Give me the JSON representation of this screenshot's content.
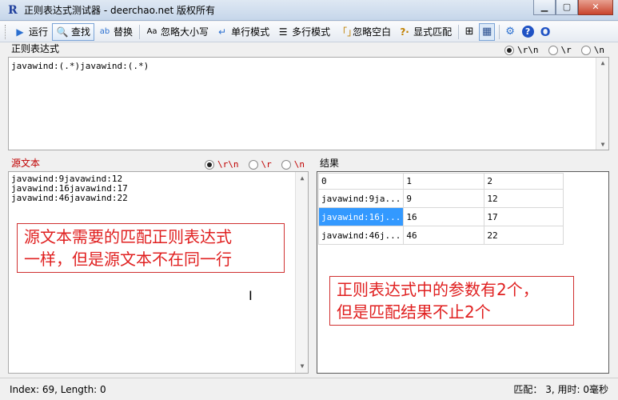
{
  "window": {
    "title": "正则表达式测试器 - deerchao.net 版权所有",
    "app_icon": "R",
    "min_label": "▁",
    "max_label": "▢",
    "close_label": "✕"
  },
  "toolbar": {
    "run": "运行",
    "find": "查找",
    "replace": "替换",
    "ignore_case": "忽略大小写",
    "single_line": "单行模式",
    "multi_line": "多行模式",
    "ignore_whitespace": "忽略空白",
    "explicit_capture": "显式匹配",
    "icons": [
      "play-icon",
      "search-icon",
      "replace-icon",
      "case-icon",
      "single-line-icon",
      "multi-line-icon",
      "whitespace-icon",
      "explicit-icon",
      "tree-view-icon",
      "grid-view-icon",
      "settings-icon",
      "help-icon",
      "about-icon"
    ]
  },
  "regex": {
    "label": "正则表达式",
    "value": "javawind:(.*)javawind:(.*)",
    "newline_options": [
      "\\r\\n",
      "\\r",
      "\\n"
    ],
    "selected_newline": 0
  },
  "source": {
    "label": "源文本",
    "lines": [
      "javawind:9javawind:12",
      "javawind:16javawind:17",
      "javawind:46javawind:22"
    ],
    "newline_options": [
      "\\r\\n",
      "\\r",
      "\\n"
    ],
    "selected_newline": 0
  },
  "results": {
    "label": "结果",
    "columns": [
      "0",
      "1",
      "2"
    ],
    "rows": [
      [
        "javawind:9ja...",
        "9",
        "12"
      ],
      [
        "javawind:16j...",
        "16",
        "17"
      ],
      [
        "javawind:46j...",
        "46",
        "22"
      ]
    ],
    "selected_row": 1
  },
  "annotations": {
    "note1_line1": "源文本需要的匹配正则表达式",
    "note1_line2": "一样，但是源文本不在同一行",
    "note2_line1": "正则表达式中的参数有2个，",
    "note2_line2": "但是匹配结果不止2个"
  },
  "status": {
    "left": "Index: 69, Length: 0",
    "right": "匹配： 3, 用时: 0毫秒"
  },
  "colors": {
    "selection": "#3399ff",
    "annotation_red": "#e02020"
  }
}
